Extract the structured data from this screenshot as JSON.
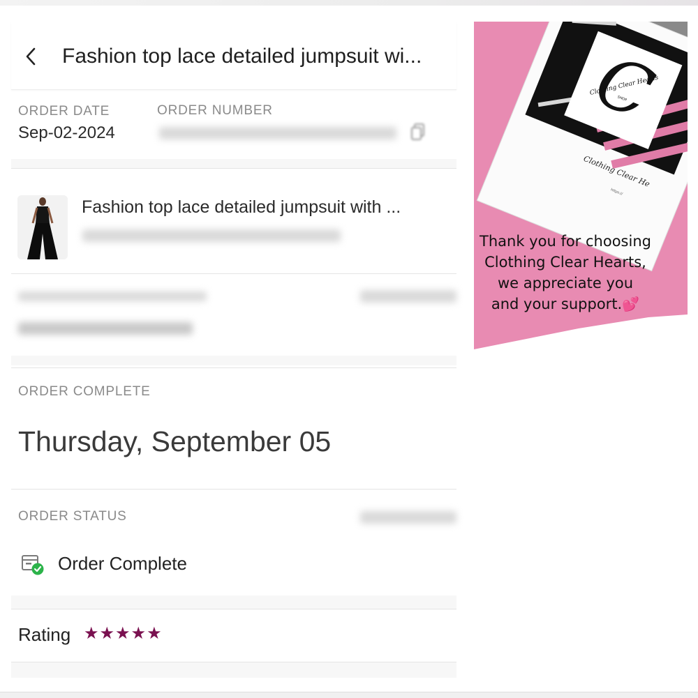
{
  "header": {
    "title": "Fashion top lace detailed jumpsuit wi..."
  },
  "order_info": {
    "order_date_label": "ORDER DATE",
    "order_date_value": "Sep-02-2024",
    "order_number_label": "ORDER NUMBER"
  },
  "item": {
    "title": "Fashion top lace detailed jumpsuit with ..."
  },
  "order_complete": {
    "label": "ORDER COMPLETE",
    "date": "Thursday, September 05"
  },
  "order_status": {
    "label": "ORDER STATUS",
    "status": "Order Complete"
  },
  "rating": {
    "label": "Rating",
    "stars": "★★★★★",
    "value": 5,
    "max": 5,
    "color": "#7a1150"
  },
  "promo": {
    "line1": "Thank you for choosing",
    "line2": "Clothing Clear Hearts,",
    "line3": "we appreciate you",
    "line4": "and your support.",
    "heart": "💕",
    "card_script": "Clothing Clear Hearts",
    "card_shop": "SHOP",
    "card_handwritten": "Clothing Clear He",
    "bg_color": "#e88bb2"
  },
  "icons": [
    "back-chevron-icon",
    "copy-icon",
    "order-complete-icon",
    "star-icon"
  ]
}
